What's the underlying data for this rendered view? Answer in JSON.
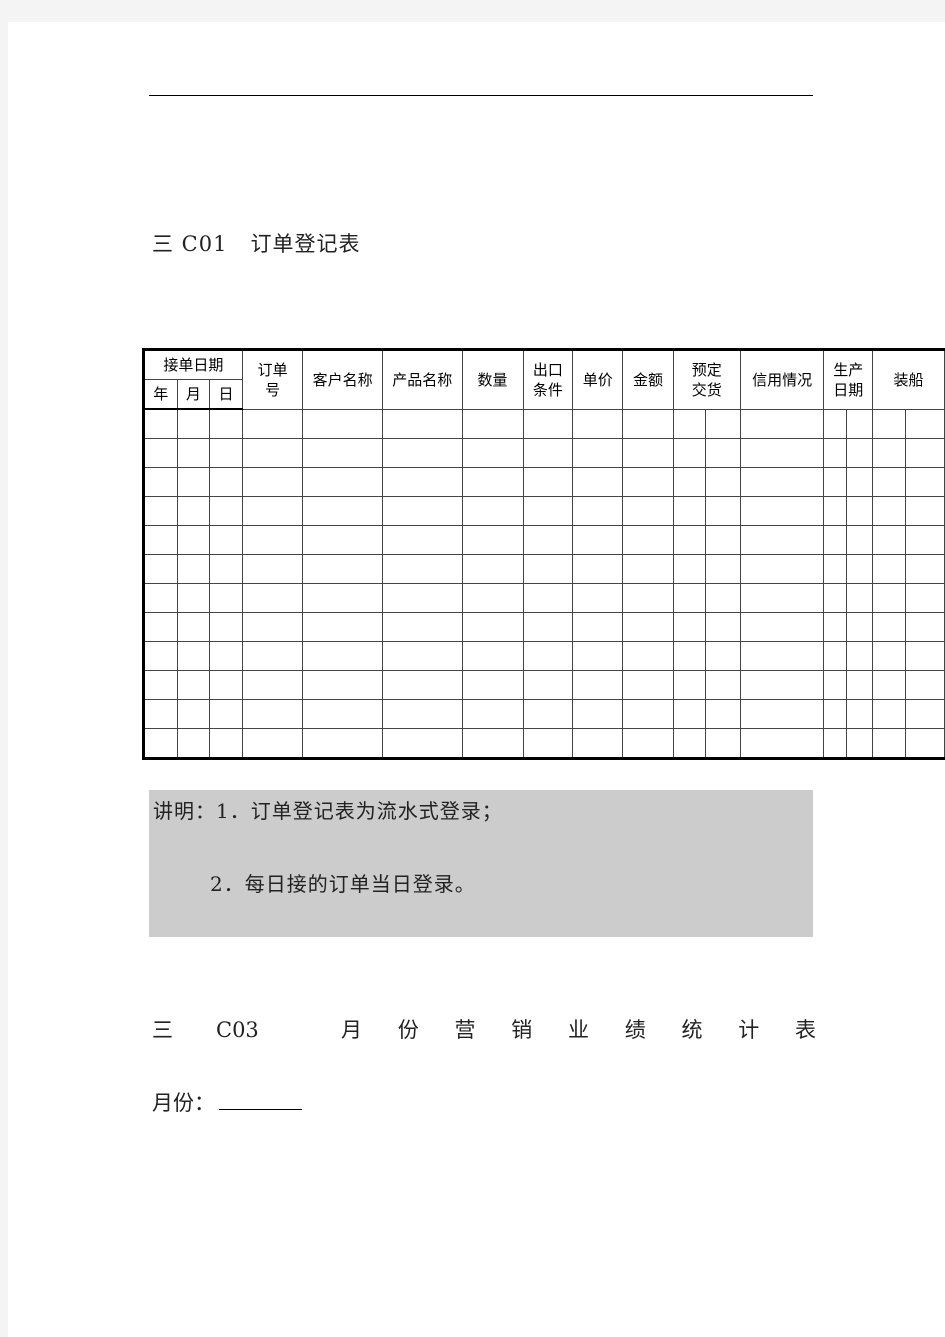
{
  "section1": {
    "title": "三 C01   订单登记表",
    "table": {
      "headers_top": [
        {
          "key": "order_date",
          "label": "接单日期",
          "colspan": 3
        },
        {
          "key": "order_no",
          "label": "订单号",
          "rowspan": 2
        },
        {
          "key": "customer_name",
          "label": "客户名称",
          "rowspan": 2
        },
        {
          "key": "product_name",
          "label": "产品名称",
          "rowspan": 2
        },
        {
          "key": "quantity",
          "label": "数量",
          "rowspan": 2
        },
        {
          "key": "export_terms",
          "label": "出口条件",
          "rowspan": 2
        },
        {
          "key": "unit_price",
          "label": "单价",
          "rowspan": 2
        },
        {
          "key": "amount",
          "label": "金额",
          "rowspan": 2
        },
        {
          "key": "scheduled_delivery",
          "label": "预定交货",
          "rowspan": 2,
          "colspan": 2
        },
        {
          "key": "credit_status",
          "label": "信用情况",
          "rowspan": 2
        },
        {
          "key": "production_date",
          "label": "生产日期",
          "rowspan": 2,
          "colspan": 2
        },
        {
          "key": "shipment",
          "label": "装船",
          "rowspan": 2,
          "colspan": 2
        }
      ],
      "headers_date_sub": [
        "年",
        "月",
        "日"
      ],
      "body_row_count": 12
    }
  },
  "notes": {
    "line1": "讲明：1．订单登记表为流水式登录；",
    "line2": "2．每日接的订单当日登录。"
  },
  "section2": {
    "prefix": "三",
    "code": "C03",
    "title_chars": [
      "月",
      "份",
      "营",
      "销",
      "业",
      "绩",
      "统",
      "计",
      "表"
    ],
    "month_label": "月份：",
    "month_value": ""
  }
}
